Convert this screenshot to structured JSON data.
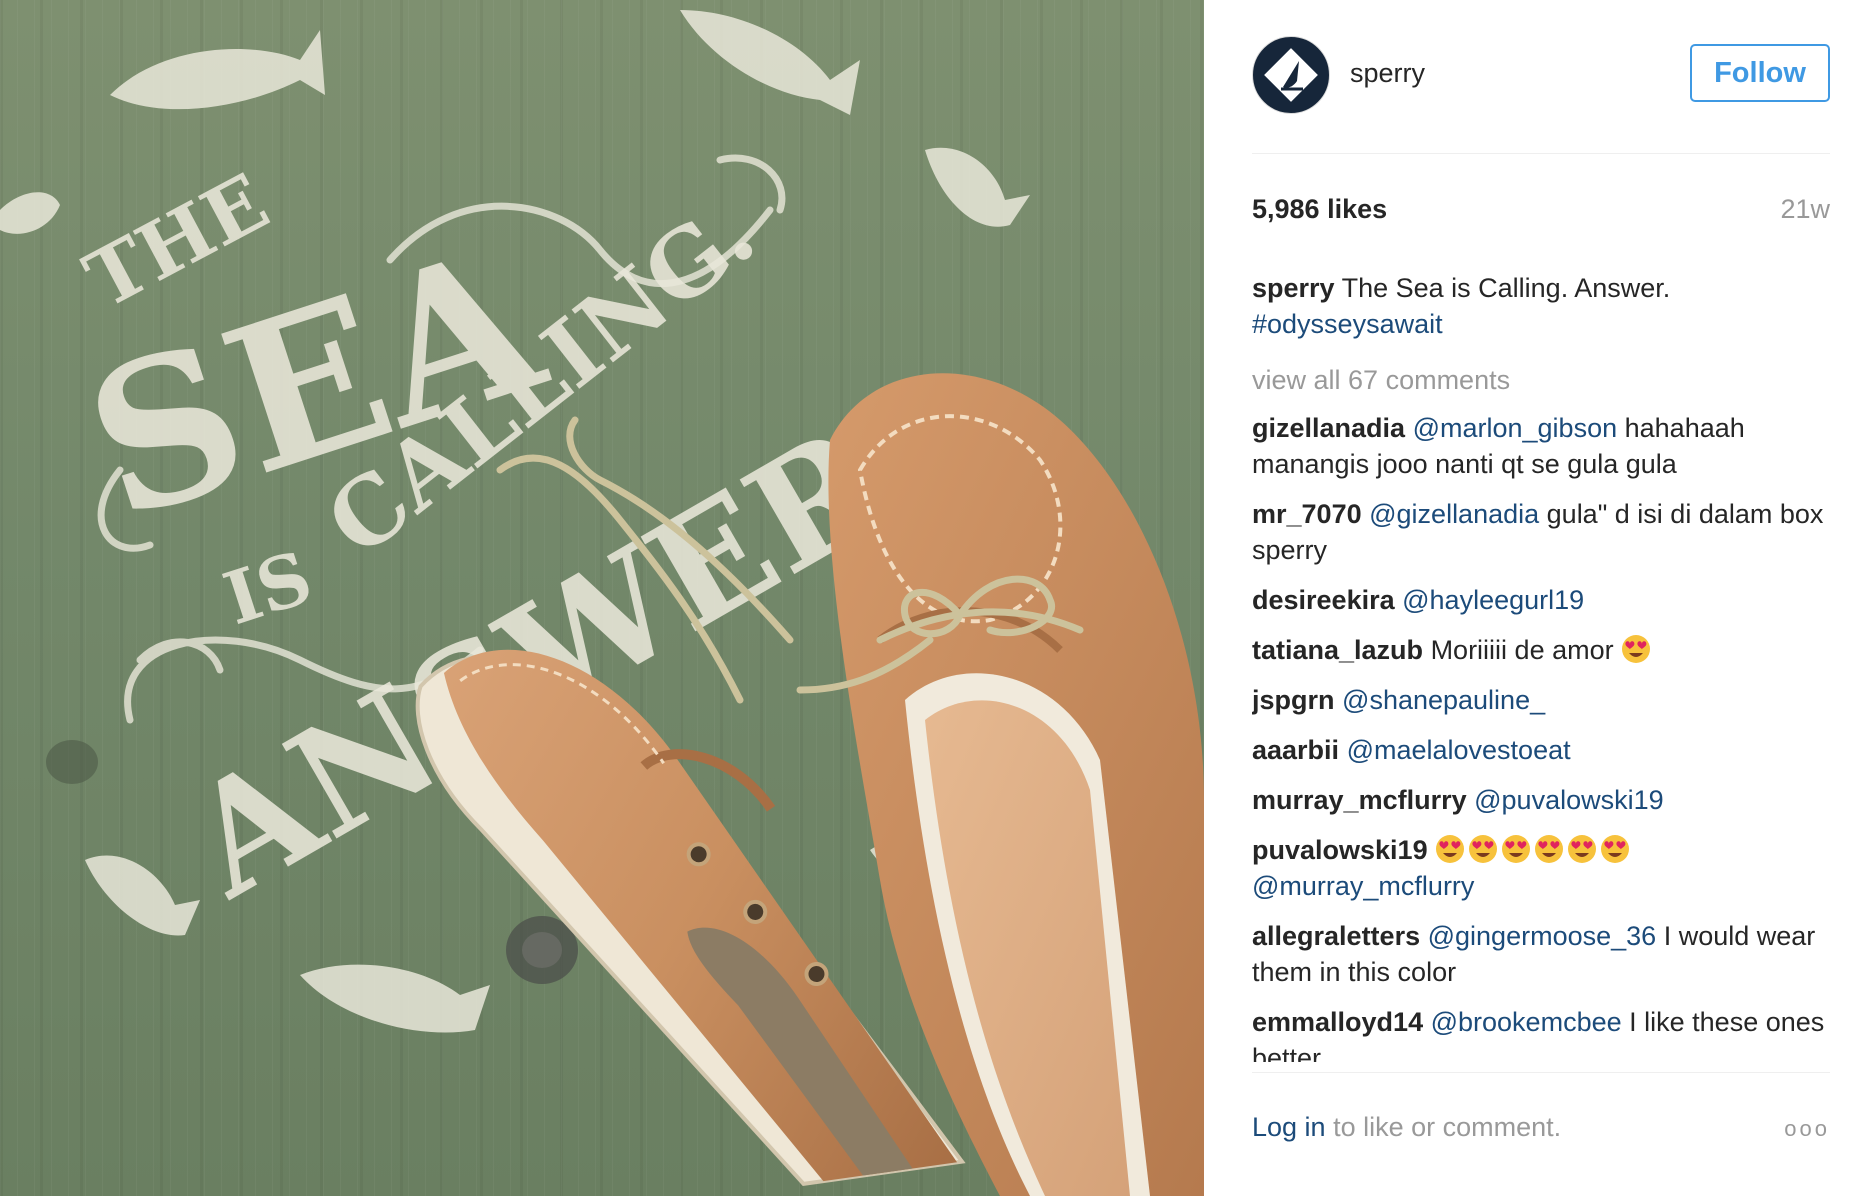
{
  "account": {
    "username": "sperry",
    "follow_label": "Follow"
  },
  "post": {
    "likes": "5,986 likes",
    "age": "21w",
    "caption": {
      "user": "sperry",
      "text": "The Sea is Calling. Answer.",
      "hashtag": "#odysseysawait"
    },
    "view_all": "view all 67 comments"
  },
  "comments": [
    {
      "user": "gizellanadia",
      "mention": "@marlon_gibson",
      "text": "hahahaah manangis jooo nanti qt se gula gula"
    },
    {
      "user": "mr_7070",
      "mention": "@gizellanadia",
      "text": "gula\" d isi di dalam box sperry"
    },
    {
      "user": "desireekira",
      "mention": "@hayleegurl19",
      "text": ""
    },
    {
      "user": "tatiana_lazub",
      "mention": "",
      "text": "Moriiiii de amor",
      "emojis": 1
    },
    {
      "user": "jspgrn",
      "mention": "@shanepauline_",
      "text": ""
    },
    {
      "user": "aaarbii",
      "mention": "@maelalovestoeat",
      "text": ""
    },
    {
      "user": "murray_mcflurry",
      "mention": "@puvalowski19",
      "text": ""
    },
    {
      "user": "puvalowski19",
      "mention_after_emoji": "@murray_mcflurry",
      "text": "",
      "emojis": 6
    },
    {
      "user": "allegraletters",
      "mention": "@gingermoose_36",
      "text": "I would wear them in this color"
    },
    {
      "user": "emmalloyd14",
      "mention": "@brookemcbee",
      "text": "I like these ones better"
    }
  ],
  "footer": {
    "login": "Log in",
    "rest": "to like or comment.",
    "more": "ooo"
  },
  "photo_text": {
    "line1": "THE",
    "line2": "SEA",
    "line3": "IS",
    "line4": "CALLING.",
    "line5": "ANSWER."
  },
  "colors": {
    "follow_blue": "#3f99e3",
    "link_blue": "#1c4b7a",
    "muted": "#999999",
    "wood_green": "#73886a"
  }
}
